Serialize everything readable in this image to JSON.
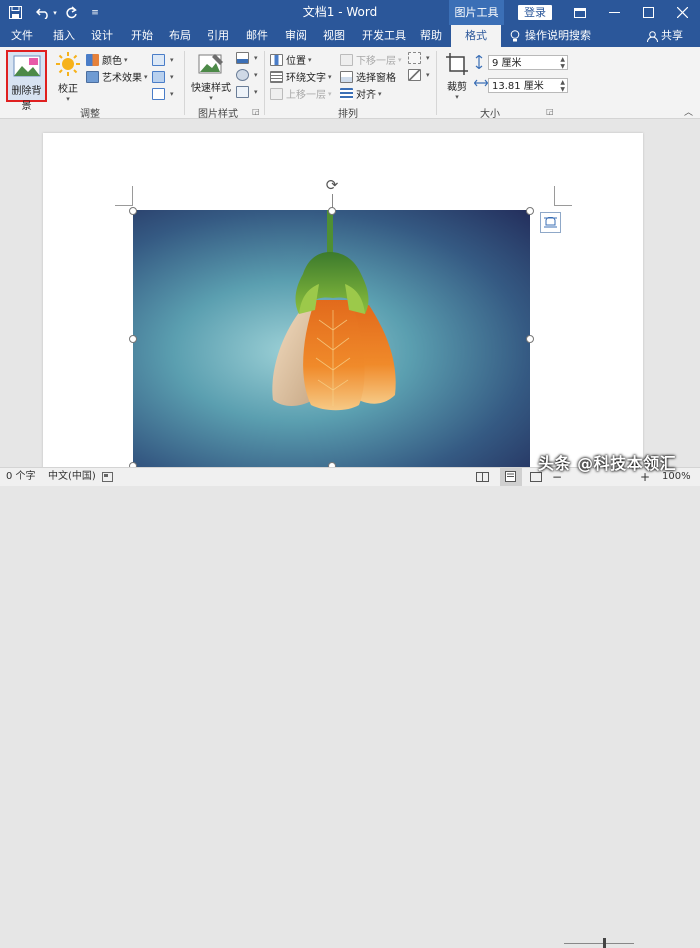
{
  "titlebar": {
    "title": "文档1 - Word",
    "context_tab_group": "图片工具",
    "login": "登录"
  },
  "tabs": [
    {
      "label": "文件"
    },
    {
      "label": "插入"
    },
    {
      "label": "设计"
    },
    {
      "label": "开始"
    },
    {
      "label": "布局"
    },
    {
      "label": "引用"
    },
    {
      "label": "邮件"
    },
    {
      "label": "审阅"
    },
    {
      "label": "视图"
    },
    {
      "label": "开发工具"
    },
    {
      "label": "帮助"
    },
    {
      "label": "格式"
    }
  ],
  "tell_me": "操作说明搜索",
  "share": "共享",
  "ribbon": {
    "adjust": {
      "remove_bg": "删除背景",
      "correct": "校正",
      "color": "颜色",
      "artistic": "艺术效果",
      "label": "调整"
    },
    "styles": {
      "quick_styles": "快速样式",
      "label": "图片样式"
    },
    "arrange": {
      "position": "位置",
      "wrap_text": "环绕文字",
      "bring_forward": "上移一层",
      "send_backward": "下移一层",
      "selection_pane": "选择窗格",
      "align": "对齐",
      "label": "排列"
    },
    "size": {
      "crop": "裁剪",
      "width": "9 厘米",
      "height": "13.81 厘米",
      "label": "大小"
    }
  },
  "status": {
    "words": "0 个字",
    "language": "中文(中国)",
    "zoom": "100%"
  },
  "watermark": "头条 @科技本领汇"
}
